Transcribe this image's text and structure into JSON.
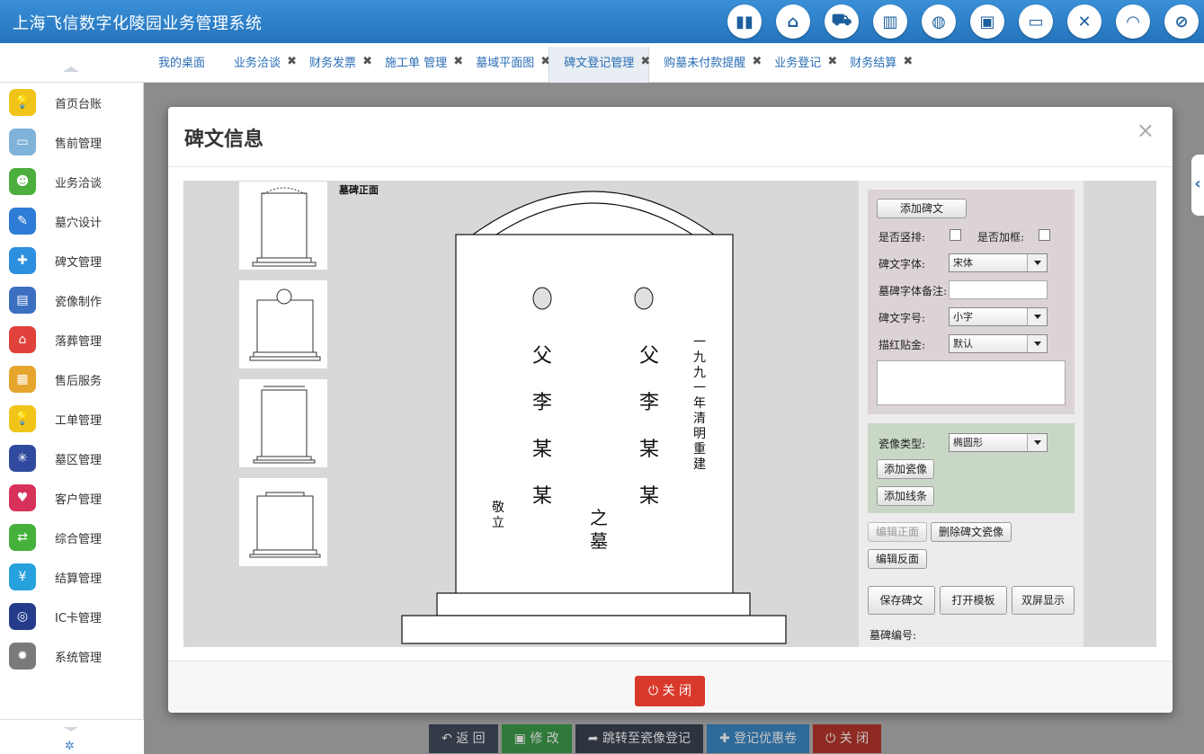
{
  "app": {
    "title": "上海飞信数字化陵园业务管理系统"
  },
  "top_icons": [
    "bar-chart-icon",
    "home-icon",
    "cart-icon",
    "building-icon",
    "globe-icon",
    "briefcase-icon",
    "monitor-icon",
    "close-icon",
    "rss-icon",
    "ban-icon"
  ],
  "tabs": [
    {
      "label": "我的桌面",
      "closable": false
    },
    {
      "label": "业务洽谈",
      "closable": true
    },
    {
      "label": "财务发票",
      "closable": true
    },
    {
      "label": "施工单 管理",
      "closable": true
    },
    {
      "label": "墓域平面图",
      "closable": true
    },
    {
      "label": "碑文登记管理",
      "closable": true,
      "active": true
    },
    {
      "label": "购墓未付款提醒",
      "closable": true
    },
    {
      "label": "业务登记",
      "closable": true
    },
    {
      "label": "财务结算",
      "closable": true
    }
  ],
  "sidebar": {
    "items": [
      {
        "label": "首页台账",
        "icon": "bulb-icon",
        "color": "#f0c419"
      },
      {
        "label": "售前管理",
        "icon": "monitor-icon",
        "color": "#7fb3d9"
      },
      {
        "label": "业务洽谈",
        "icon": "user-icon",
        "color": "#4cae3c"
      },
      {
        "label": "墓穴设计",
        "icon": "pen-icon",
        "color": "#2e7cd6"
      },
      {
        "label": "碑文管理",
        "icon": "wrench-icon",
        "color": "#2d8fe0"
      },
      {
        "label": "瓷像制作",
        "icon": "photo-icon",
        "color": "#3b6fc0"
      },
      {
        "label": "落葬管理",
        "icon": "house-icon",
        "color": "#e0413a"
      },
      {
        "label": "售后服务",
        "icon": "clipboard-icon",
        "color": "#e6a52d"
      },
      {
        "label": "工单管理",
        "icon": "bulb-icon",
        "color": "#f0c419"
      },
      {
        "label": "墓区管理",
        "icon": "network-icon",
        "color": "#2f4a9e"
      },
      {
        "label": "客户管理",
        "icon": "heart-icon",
        "color": "#d7325a"
      },
      {
        "label": "综合管理",
        "icon": "shuffle-icon",
        "color": "#45b03a"
      },
      {
        "label": "结算管理",
        "icon": "yen-icon",
        "color": "#27a0de"
      },
      {
        "label": "IC卡管理",
        "icon": "radio-icon",
        "color": "#243c8a"
      },
      {
        "label": "系统管理",
        "icon": "gear-icon",
        "color": "#7a7a7a"
      }
    ]
  },
  "background_buttons": [
    {
      "label": "返 回",
      "icon": "reply-icon",
      "color": "#333b48"
    },
    {
      "label": "修 改",
      "icon": "save-icon",
      "color": "#2f7a3a"
    },
    {
      "label": "跳转至瓷像登记",
      "icon": "share-icon",
      "color": "#2d3440"
    },
    {
      "label": "登记优惠卷",
      "icon": "plus-icon",
      "color": "#2e6a9a"
    },
    {
      "label": "关 闭",
      "icon": "power-icon",
      "color": "#8f2a22"
    }
  ],
  "modal": {
    "title": "碑文信息",
    "close_symbol": "×",
    "close_button": "关 闭",
    "stone": {
      "front_label": "墓碑正面",
      "col1": [
        "父",
        "李",
        "某",
        "某"
      ],
      "col2": [
        "父",
        "李",
        "某",
        "某"
      ],
      "date_text": [
        "一",
        "九",
        "九",
        "一",
        "年",
        "清",
        "明",
        "重",
        "建"
      ],
      "respect": [
        "敬",
        "立"
      ],
      "tomb": [
        "之",
        "墓"
      ]
    },
    "panel": {
      "add_text_btn": "添加碑文",
      "vertical_label": "是否竖排:",
      "frame_label": "是否加框:",
      "font_label": "碑文字体:",
      "font_value": "宋体",
      "font_note_label": "墓碑字体备注:",
      "size_label": "碑文字号:",
      "size_value": "小字",
      "gold_label": "描红贴金:",
      "gold_value": "默认",
      "photo_type_label": "瓷像类型:",
      "photo_type_value": "椭圆形",
      "add_photo_btn": "添加瓷像",
      "add_line_btn": "添加线条",
      "edit_front_btn": "编辑正面",
      "delete_btn": "删除碑文瓷像",
      "edit_back_btn": "编辑反面",
      "save_btn": "保存碑文",
      "open_template_btn": "打开模板",
      "dual_screen_btn": "双屏显示",
      "stone_no_label": "墓碑编号:"
    }
  }
}
